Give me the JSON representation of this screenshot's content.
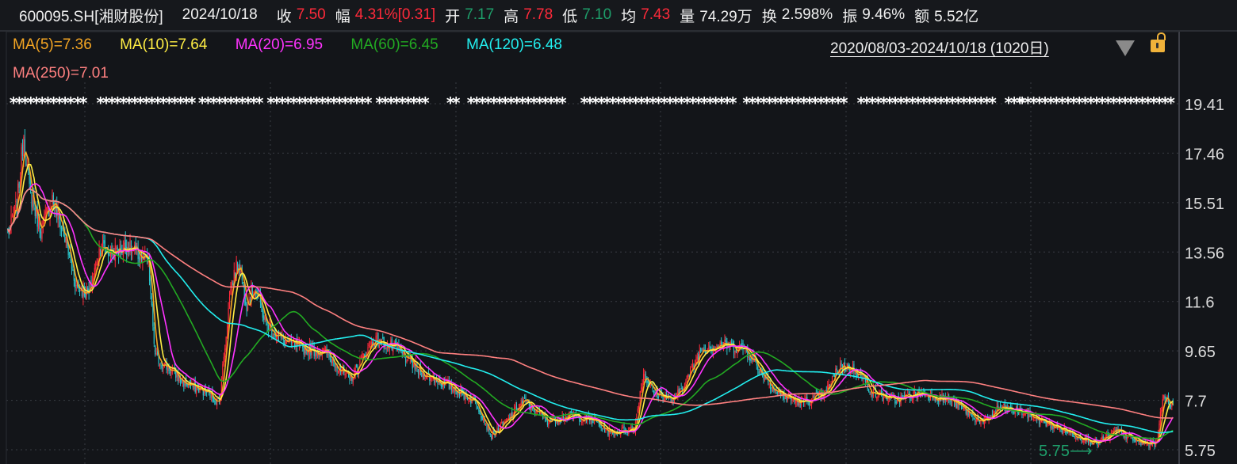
{
  "header": {
    "symbol": "600095.SH[湘财股份]",
    "date": "2024/10/18",
    "close_label": "收",
    "close": "7.50",
    "change_label": "幅",
    "change": "4.31%[0.31]",
    "open_label": "开",
    "open": "7.17",
    "high_label": "高",
    "high": "7.78",
    "low_label": "低",
    "low": "7.10",
    "avg_label": "均",
    "avg": "7.43",
    "volume_label": "量",
    "volume": "74.29万",
    "turnover_label": "换",
    "turnover": "2.598%",
    "amplitude_label": "振",
    "amplitude": "9.46%",
    "amount_label": "额",
    "amount": "5.52亿"
  },
  "legend": [
    {
      "text": "MA(5)=7.36",
      "color": "#f5a623"
    },
    {
      "text": "MA(10)=7.64",
      "color": "#ffee44"
    },
    {
      "text": "MA(20)=6.95",
      "color": "#ff33ff"
    },
    {
      "text": "MA(60)=6.45",
      "color": "#22aa22"
    },
    {
      "text": "MA(120)=6.48",
      "color": "#22eeee"
    },
    {
      "text": "MA(250)=7.01",
      "color": "#ff8080"
    }
  ],
  "range_label": "2020/08/03-2024/10/18 (1020日)",
  "colors": {
    "up": "#ff2a3a",
    "down": "#2ac6cc",
    "low_marker": "#1e9e6a"
  },
  "chart_data": {
    "type": "candlestick",
    "title": "600095.SH 湘财股份 daily",
    "days": 1020,
    "ylim": [
      5.75,
      19.41
    ],
    "yticks": [
      "19.41",
      "17.46",
      "15.51",
      "13.56",
      "11.6",
      "9.65",
      "7.7",
      "5.75"
    ],
    "ma_periods": [
      5,
      10,
      20,
      60,
      120,
      250
    ],
    "close_anchors": [
      [
        1,
        14.4
      ],
      [
        8,
        15.4
      ],
      [
        14,
        18.2
      ],
      [
        19,
        16.0
      ],
      [
        29,
        14.4
      ],
      [
        39,
        15.7
      ],
      [
        50,
        14.1
      ],
      [
        60,
        12.2
      ],
      [
        71,
        11.9
      ],
      [
        81,
        13.8
      ],
      [
        91,
        13.5
      ],
      [
        105,
        13.8
      ],
      [
        123,
        13.1
      ],
      [
        129,
        9.4
      ],
      [
        140,
        9.0
      ],
      [
        154,
        8.4
      ],
      [
        175,
        8.0
      ],
      [
        185,
        7.6
      ],
      [
        195,
        12.2
      ],
      [
        202,
        13.2
      ],
      [
        209,
        11.5
      ],
      [
        216,
        12.2
      ],
      [
        226,
        10.7
      ],
      [
        240,
        10.1
      ],
      [
        257,
        9.75
      ],
      [
        278,
        9.6
      ],
      [
        299,
        8.5
      ],
      [
        320,
        10.1
      ],
      [
        340,
        9.75
      ],
      [
        361,
        8.8
      ],
      [
        389,
        8.2
      ],
      [
        410,
        7.6
      ],
      [
        423,
        6.3
      ],
      [
        437,
        6.9
      ],
      [
        451,
        7.7
      ],
      [
        472,
        6.9
      ],
      [
        493,
        7.1
      ],
      [
        513,
        6.9
      ],
      [
        527,
        6.4
      ],
      [
        548,
        6.6
      ],
      [
        556,
        8.8
      ],
      [
        565,
        8.0
      ],
      [
        583,
        7.7
      ],
      [
        597,
        8.8
      ],
      [
        607,
        9.75
      ],
      [
        624,
        9.9
      ],
      [
        645,
        9.75
      ],
      [
        659,
        8.8
      ],
      [
        673,
        8.0
      ],
      [
        693,
        7.6
      ],
      [
        714,
        7.9
      ],
      [
        728,
        9.1
      ],
      [
        745,
        8.8
      ],
      [
        756,
        8.0
      ],
      [
        776,
        7.7
      ],
      [
        797,
        8.0
      ],
      [
        825,
        7.7
      ],
      [
        853,
        6.8
      ],
      [
        867,
        7.4
      ],
      [
        887,
        7.25
      ],
      [
        908,
        6.8
      ],
      [
        936,
        6.3
      ],
      [
        953,
        6.0
      ],
      [
        970,
        6.5
      ],
      [
        991,
        6.0
      ],
      [
        1004,
        6.0
      ],
      [
        1011,
        7.9
      ],
      [
        1019,
        7.5
      ]
    ],
    "low_annotation": {
      "text": "5.75⟶",
      "value": 5.75
    },
    "event_marker_glyph": "*",
    "event_marker_ranges": [
      [
        5,
        57
      ],
      [
        61,
        70
      ],
      [
        81,
        164
      ],
      [
        170,
        223
      ],
      [
        230,
        316
      ],
      [
        325,
        335
      ],
      [
        340,
        368
      ],
      [
        387,
        396
      ],
      [
        405,
        487
      ],
      [
        504,
        638
      ],
      [
        646,
        732
      ],
      [
        746,
        864
      ],
      [
        875,
        885
      ],
      [
        887,
        1019
      ]
    ]
  }
}
